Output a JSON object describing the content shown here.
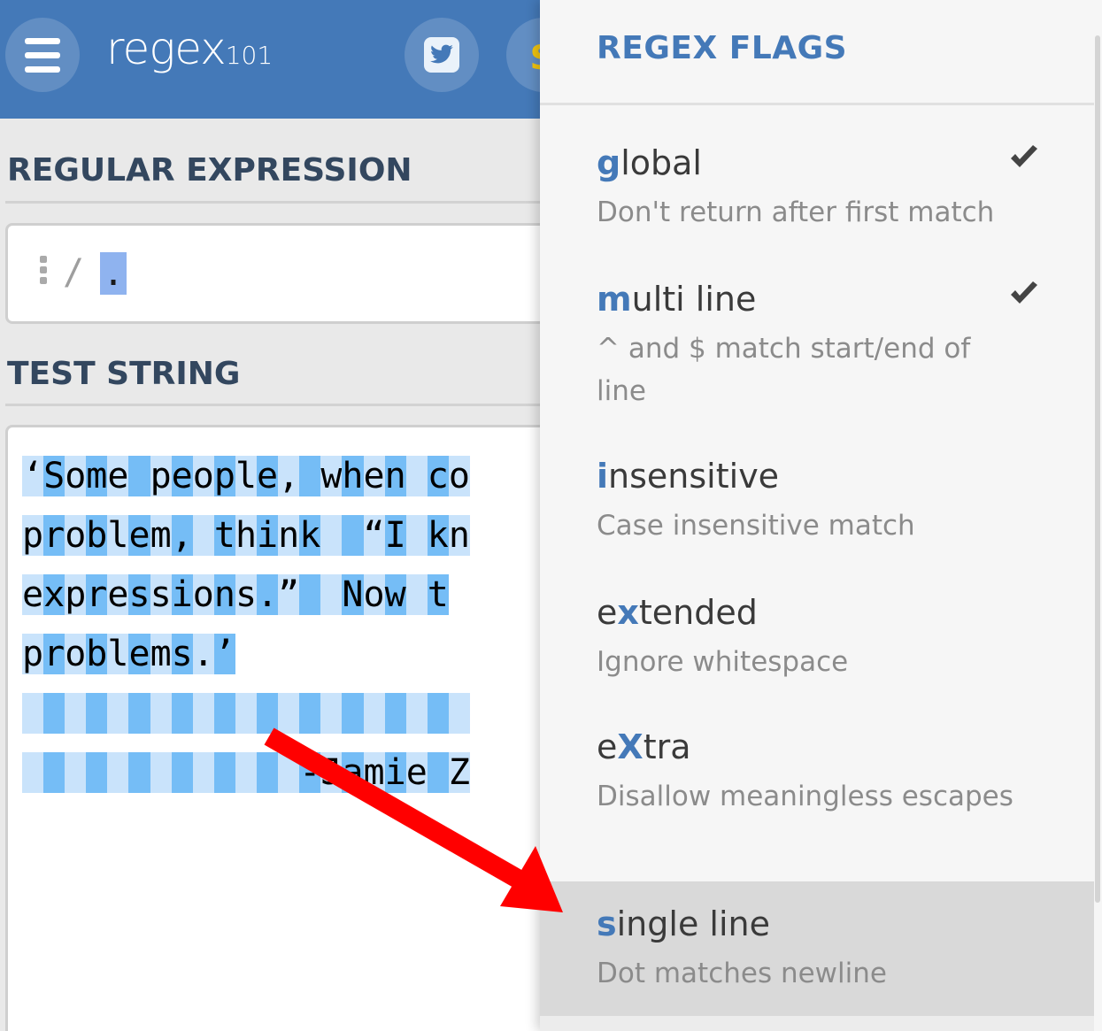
{
  "header": {
    "logo_main": "regex",
    "logo_sub": "101",
    "icons": [
      "menu-icon",
      "twitter-icon",
      "dollar-icon"
    ],
    "brand_color": "#4479b8"
  },
  "regex_section": {
    "title": "REGULAR EXPRESSION",
    "delimiter": "/",
    "pattern": "."
  },
  "test_section": {
    "title": "TEST STRING",
    "lines": [
      "‘Some people, when co",
      "problem, think  “I kn",
      "expressions.”  Now t",
      "problems.’",
      "",
      "             -Jamie Z"
    ]
  },
  "flags_panel": {
    "title": "REGEX FLAGS",
    "flags": [
      {
        "key": "g",
        "rest": "lobal",
        "description": "Don't return after first match",
        "checked": true,
        "selected": false
      },
      {
        "key": "m",
        "rest": "ulti line",
        "description": "^ and $ match start/end of line",
        "checked": true,
        "selected": false
      },
      {
        "key": "i",
        "rest": "nsensitive",
        "description": "Case insensitive match",
        "checked": false,
        "selected": false
      },
      {
        "prefix": "e",
        "key": "x",
        "rest": "tended",
        "description": "Ignore whitespace",
        "checked": false,
        "selected": false
      },
      {
        "prefix": "e",
        "key": "X",
        "rest": "tra",
        "description": "Disallow meaningless escapes",
        "checked": false,
        "selected": false
      },
      {
        "key": "s",
        "rest": "ingle line",
        "description": "Dot matches newline",
        "checked": false,
        "selected": true
      }
    ]
  },
  "annotation": {
    "arrow_color": "#ff0000"
  }
}
